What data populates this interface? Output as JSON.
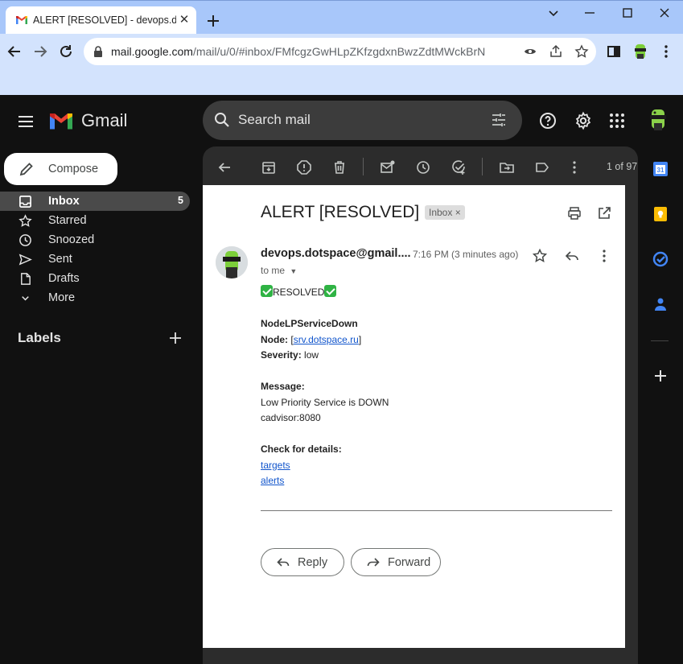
{
  "browser": {
    "tab_title": "ALERT [RESOLVED] - devops.dotspace@gmail.com - Gmail",
    "url_host": "mail.google.com",
    "url_path": "/mail/u/0/#inbox/FMfcgzGwHLpZKfzgdxnBwzZdtMWckBrN"
  },
  "gmail": {
    "product_name": "Gmail",
    "search_placeholder": "Search mail",
    "compose_label": "Compose",
    "nav": [
      {
        "label": "Inbox",
        "count": "5",
        "icon": "inbox-icon"
      },
      {
        "label": "Starred",
        "count": "",
        "icon": "star-icon"
      },
      {
        "label": "Snoozed",
        "count": "",
        "icon": "clock-icon"
      },
      {
        "label": "Sent",
        "count": "",
        "icon": "send-icon"
      },
      {
        "label": "Drafts",
        "count": "",
        "icon": "draft-icon"
      },
      {
        "label": "More",
        "count": "",
        "icon": "chevron-down-icon"
      }
    ],
    "labels_heading": "Labels",
    "pager": "1 of 97"
  },
  "email": {
    "subject": "ALERT [RESOLVED]",
    "folder_chip": "Inbox",
    "chip_close": "×",
    "sender": "devops.dotspace@gmail....",
    "time": "7:16 PM (3 minutes ago)",
    "recipient": "to me",
    "body": {
      "status": "RESOLVED",
      "alert_name": "NodeLPServiceDown",
      "node_label": "Node:",
      "node_open": "[",
      "node_value": "srv.dotspace.ru",
      "node_close": "]",
      "severity_label": "Severity:",
      "severity_value": "low",
      "message_label": "Message:",
      "message_line1": "Low Priority Service is DOWN",
      "message_line2": "cadvisor:8080",
      "details_label": "Check for details:",
      "link1": "targets",
      "link2": "alerts"
    },
    "reply_label": "Reply",
    "forward_label": "Forward"
  },
  "side_panel": {
    "calendar_day": "31"
  },
  "colors": {
    "gmail_bg": "#111111",
    "panel_bg": "#2c2c2c",
    "chrome_tabstrip": "#a8c7fa",
    "chrome_toolbar": "#d3e3fd",
    "link": "#1155cc"
  }
}
